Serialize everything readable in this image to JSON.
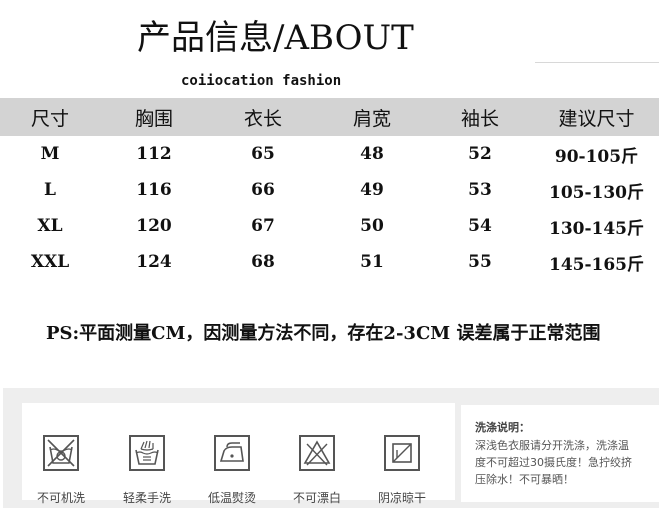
{
  "header": {
    "title": "产品信息/ABOUT",
    "brand": "coiiocation fashion"
  },
  "size_table": {
    "headers": [
      "尺寸",
      "胸围",
      "衣长",
      "肩宽",
      "袖长",
      "建议尺寸"
    ],
    "rows": [
      [
        "M",
        "112",
        "65",
        "48",
        "52",
        "90-105斤"
      ],
      [
        "L",
        "116",
        "66",
        "49",
        "53",
        "105-130斤"
      ],
      [
        "XL",
        "120",
        "67",
        "50",
        "54",
        "130-145斤"
      ],
      [
        "XXL",
        "124",
        "68",
        "51",
        "55",
        "145-165斤"
      ]
    ]
  },
  "note": "PS:平面测量CM，因测量方法不同，存在2-3CM 误差属于正常范围",
  "care": {
    "icons": [
      {
        "icon": "no-machine-wash-icon",
        "label": "不可机洗"
      },
      {
        "icon": "gentle-hand-wash-icon",
        "label": "轻柔手洗"
      },
      {
        "icon": "low-iron-icon",
        "label": "低温熨烫"
      },
      {
        "icon": "no-bleach-icon",
        "label": "不可漂白"
      },
      {
        "icon": "shade-dry-icon",
        "label": "阴凉晾干"
      }
    ],
    "heading": "洗涤说明：",
    "lines": [
      "深浅色衣服请分开洗涤，洗涤温",
      "度不可超过30摄氏度！急拧绞挤",
      "压除水！不可暴晒！"
    ]
  }
}
